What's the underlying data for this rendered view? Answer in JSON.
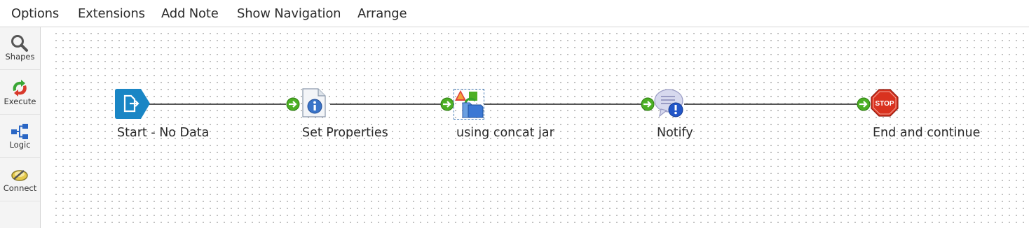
{
  "menu": {
    "items": [
      "Options",
      "Extensions",
      "Add Note",
      "Show Navigation",
      "Arrange"
    ]
  },
  "palette": {
    "items": [
      {
        "label": "Shapes",
        "icon": "search-icon"
      },
      {
        "label": "Execute",
        "icon": "execute-icon"
      },
      {
        "label": "Logic",
        "icon": "logic-icon"
      },
      {
        "label": "Connect",
        "icon": "connect-icon"
      }
    ]
  },
  "process": {
    "shapes": [
      {
        "label": "Start - No Data",
        "icon": "start-icon"
      },
      {
        "label": "Set Properties",
        "icon": "set-properties-icon"
      },
      {
        "label": "using concat jar",
        "icon": "data-process-icon"
      },
      {
        "label": "Notify",
        "icon": "notify-icon"
      },
      {
        "label": "End and continue",
        "icon": "stop-icon"
      }
    ]
  },
  "colors": {
    "start_blue": "#1a86c5",
    "connector": "#555555",
    "arrow_green": "#4caf24",
    "stop_red": "#d9321f"
  }
}
